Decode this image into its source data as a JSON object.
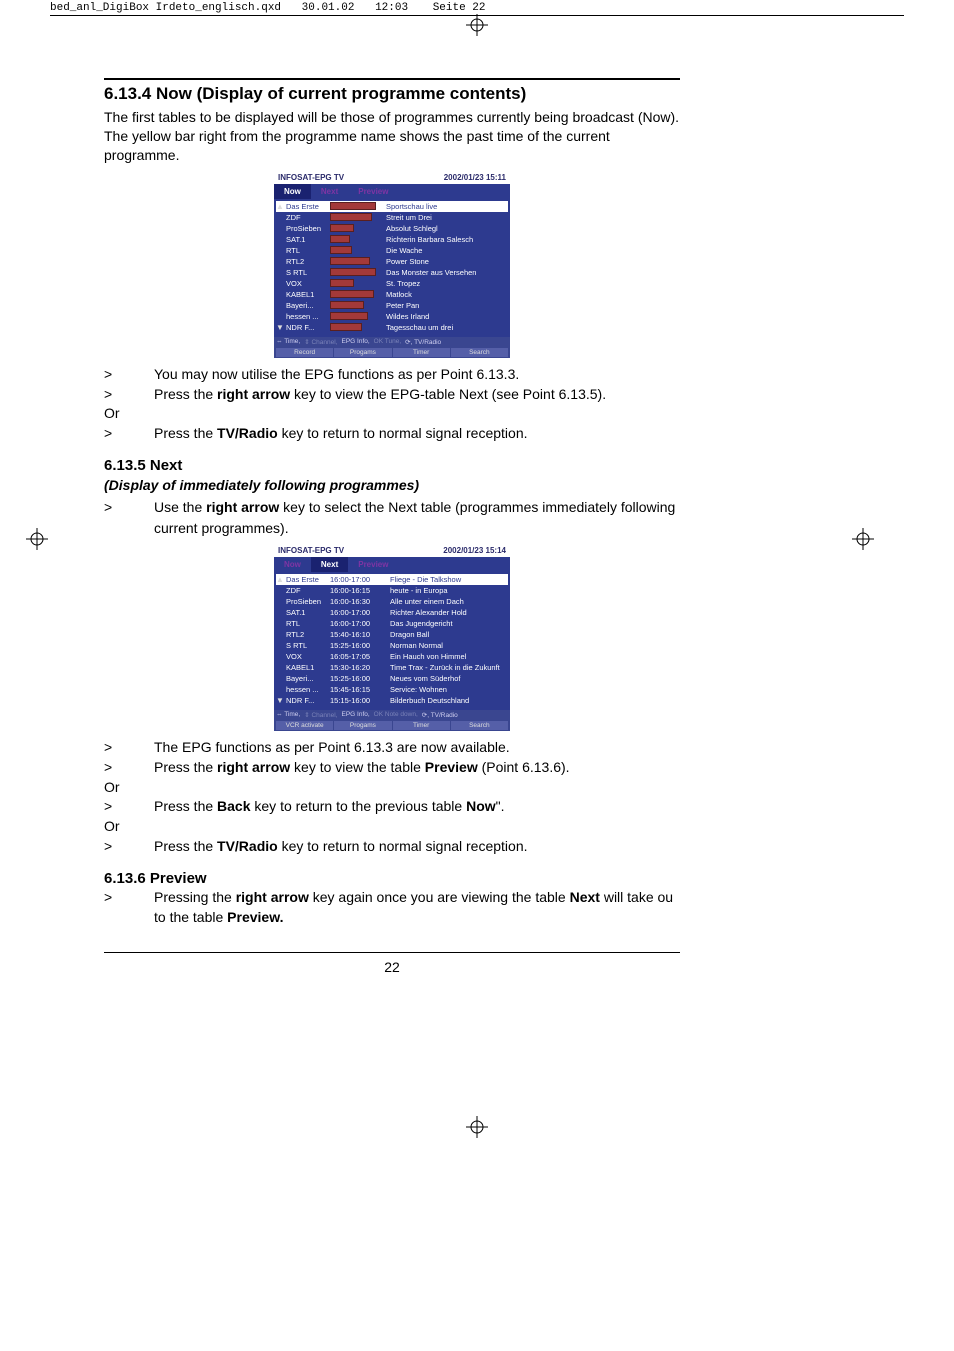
{
  "meta": {
    "filename": "bed_anl_DigiBox Irdeto_englisch.qxd",
    "date": "30.01.02",
    "time": "12:03",
    "pagelabel": "Seite 22"
  },
  "section_6_13_4": {
    "heading": "6.13.4 Now (Display of current programme contents)",
    "intro": "The first tables to be displayed will be those of programmes currently being broadcast (Now). The yellow bar right from the programme name shows the past time of the current programme.",
    "step1": {
      "pre": "You may now utilise the EPG functions as per Point 6.13.3."
    },
    "step2": {
      "pre": "Press the ",
      "b": "right arrow",
      "post": " key to view the EPG-table Next (see Point 6.13.5)."
    },
    "or1": "Or",
    "step3": {
      "pre": "Press the ",
      "b": "TV/Radio",
      "post": " key to return to normal signal reception."
    }
  },
  "section_6_13_5": {
    "heading": "6.13.5 Next",
    "subhead": "(Display of immediately following programmes)",
    "step1": {
      "pre": "Use the ",
      "b": "right arrow",
      "post": " key to select the Next table (programmes immediately following current programmes)."
    },
    "step2": {
      "pre": "The EPG functions as per Point 6.13.3 are now available."
    },
    "step3": {
      "pre": "Press the ",
      "b": "right arrow",
      "mid": " key to view the table ",
      "b2": "Preview",
      "post": " (Point 6.13.6)."
    },
    "or1": "Or",
    "step4": {
      "pre": "Press the ",
      "b": "Back",
      "mid": " key to return to the previous table ",
      "b2": "Now",
      "post": "\"."
    },
    "or2": "Or",
    "step5": {
      "pre": "Press the ",
      "b": "TV/Radio",
      "post": " key to return to normal signal reception."
    }
  },
  "section_6_13_6": {
    "heading": "6.13.6 Preview",
    "step1": {
      "pre": "Pressing the ",
      "b": "right arrow",
      "mid": " key again once you are viewing the table ",
      "b2": "Next",
      "mid2": " will take ou to the table ",
      "b3": "Preview."
    }
  },
  "epg_now": {
    "title_left": "INFOSAT-EPG TV",
    "title_right": "2002/01/23  15:11",
    "tabs": [
      "Now",
      "Next",
      "Preview"
    ],
    "active_tab": 0,
    "rows": [
      {
        "ch": "Das Erste",
        "bar": 44,
        "prog": "Sportschau live",
        "sel": true
      },
      {
        "ch": "ZDF",
        "bar": 40,
        "prog": "Streit um Drei"
      },
      {
        "ch": "ProSieben",
        "bar": 22,
        "prog": "Absolut Schlegl"
      },
      {
        "ch": "SAT.1",
        "bar": 18,
        "prog": "Richterin Barbara Salesch"
      },
      {
        "ch": "RTL",
        "bar": 20,
        "prog": "Die Wache"
      },
      {
        "ch": "RTL2",
        "bar": 38,
        "prog": "Power Stone"
      },
      {
        "ch": "S RTL",
        "bar": 44,
        "prog": "Das Monster aus Versehen"
      },
      {
        "ch": "VOX",
        "bar": 22,
        "prog": "St. Tropez"
      },
      {
        "ch": "KABEL1",
        "bar": 42,
        "prog": "Matlock"
      },
      {
        "ch": "Bayeri...",
        "bar": 32,
        "prog": "Peter Pan"
      },
      {
        "ch": "hessen ...",
        "bar": 36,
        "prog": "Wildes Irland"
      },
      {
        "ch": "NDR F...",
        "bar": 30,
        "prog": "Tagesschau um drei"
      }
    ],
    "footer_line": [
      "⇔ Time,",
      "⇕ Channel,",
      "EPG Info,",
      "OK Tune,",
      "⟳, TV/Radio"
    ],
    "footer_btns": [
      "Record",
      "Progams",
      "Timer",
      "Search"
    ]
  },
  "epg_next": {
    "title_left": "INFOSAT-EPG TV",
    "title_right": "2002/01/23  15:14",
    "tabs": [
      "Now",
      "Next",
      "Preview"
    ],
    "active_tab": 1,
    "rows": [
      {
        "ch": "Das Erste",
        "time": "16:00-17:00",
        "prog": "Fliege - Die Talkshow",
        "sel": true
      },
      {
        "ch": "ZDF",
        "time": "16:00-16:15",
        "prog": "heute - in Europa"
      },
      {
        "ch": "ProSieben",
        "time": "16:00-16:30",
        "prog": "Alle unter einem Dach"
      },
      {
        "ch": "SAT.1",
        "time": "16:00-17:00",
        "prog": "Richter Alexander Hold"
      },
      {
        "ch": "RTL",
        "time": "16:00-17:00",
        "prog": "Das Jugendgericht"
      },
      {
        "ch": "RTL2",
        "time": "15:40-16:10",
        "prog": "Dragon Ball"
      },
      {
        "ch": "S RTL",
        "time": "15:25-16:00",
        "prog": "Norman Normal"
      },
      {
        "ch": "VOX",
        "time": "16:05-17:05",
        "prog": "Ein Hauch von Himmel"
      },
      {
        "ch": "KABEL1",
        "time": "15:30-16:20",
        "prog": "Time Trax - Zurück in die Zukunft"
      },
      {
        "ch": "Bayeri...",
        "time": "15:25-16:00",
        "prog": "Neues vom Süderhof"
      },
      {
        "ch": "hessen ...",
        "time": "15:45-16:15",
        "prog": "Service: Wohnen"
      },
      {
        "ch": "NDR F...",
        "time": "15:15-16:00",
        "prog": "Bilderbuch Deutschland"
      }
    ],
    "footer_line": [
      "⇔ Time,",
      "⇕ Channel,",
      "EPG Info,",
      "OK Note down,",
      "⟳, TV/Radio"
    ],
    "footer_btns": [
      "VCR activate",
      "Progams",
      "Timer",
      "Search"
    ]
  },
  "pagenum": "22"
}
